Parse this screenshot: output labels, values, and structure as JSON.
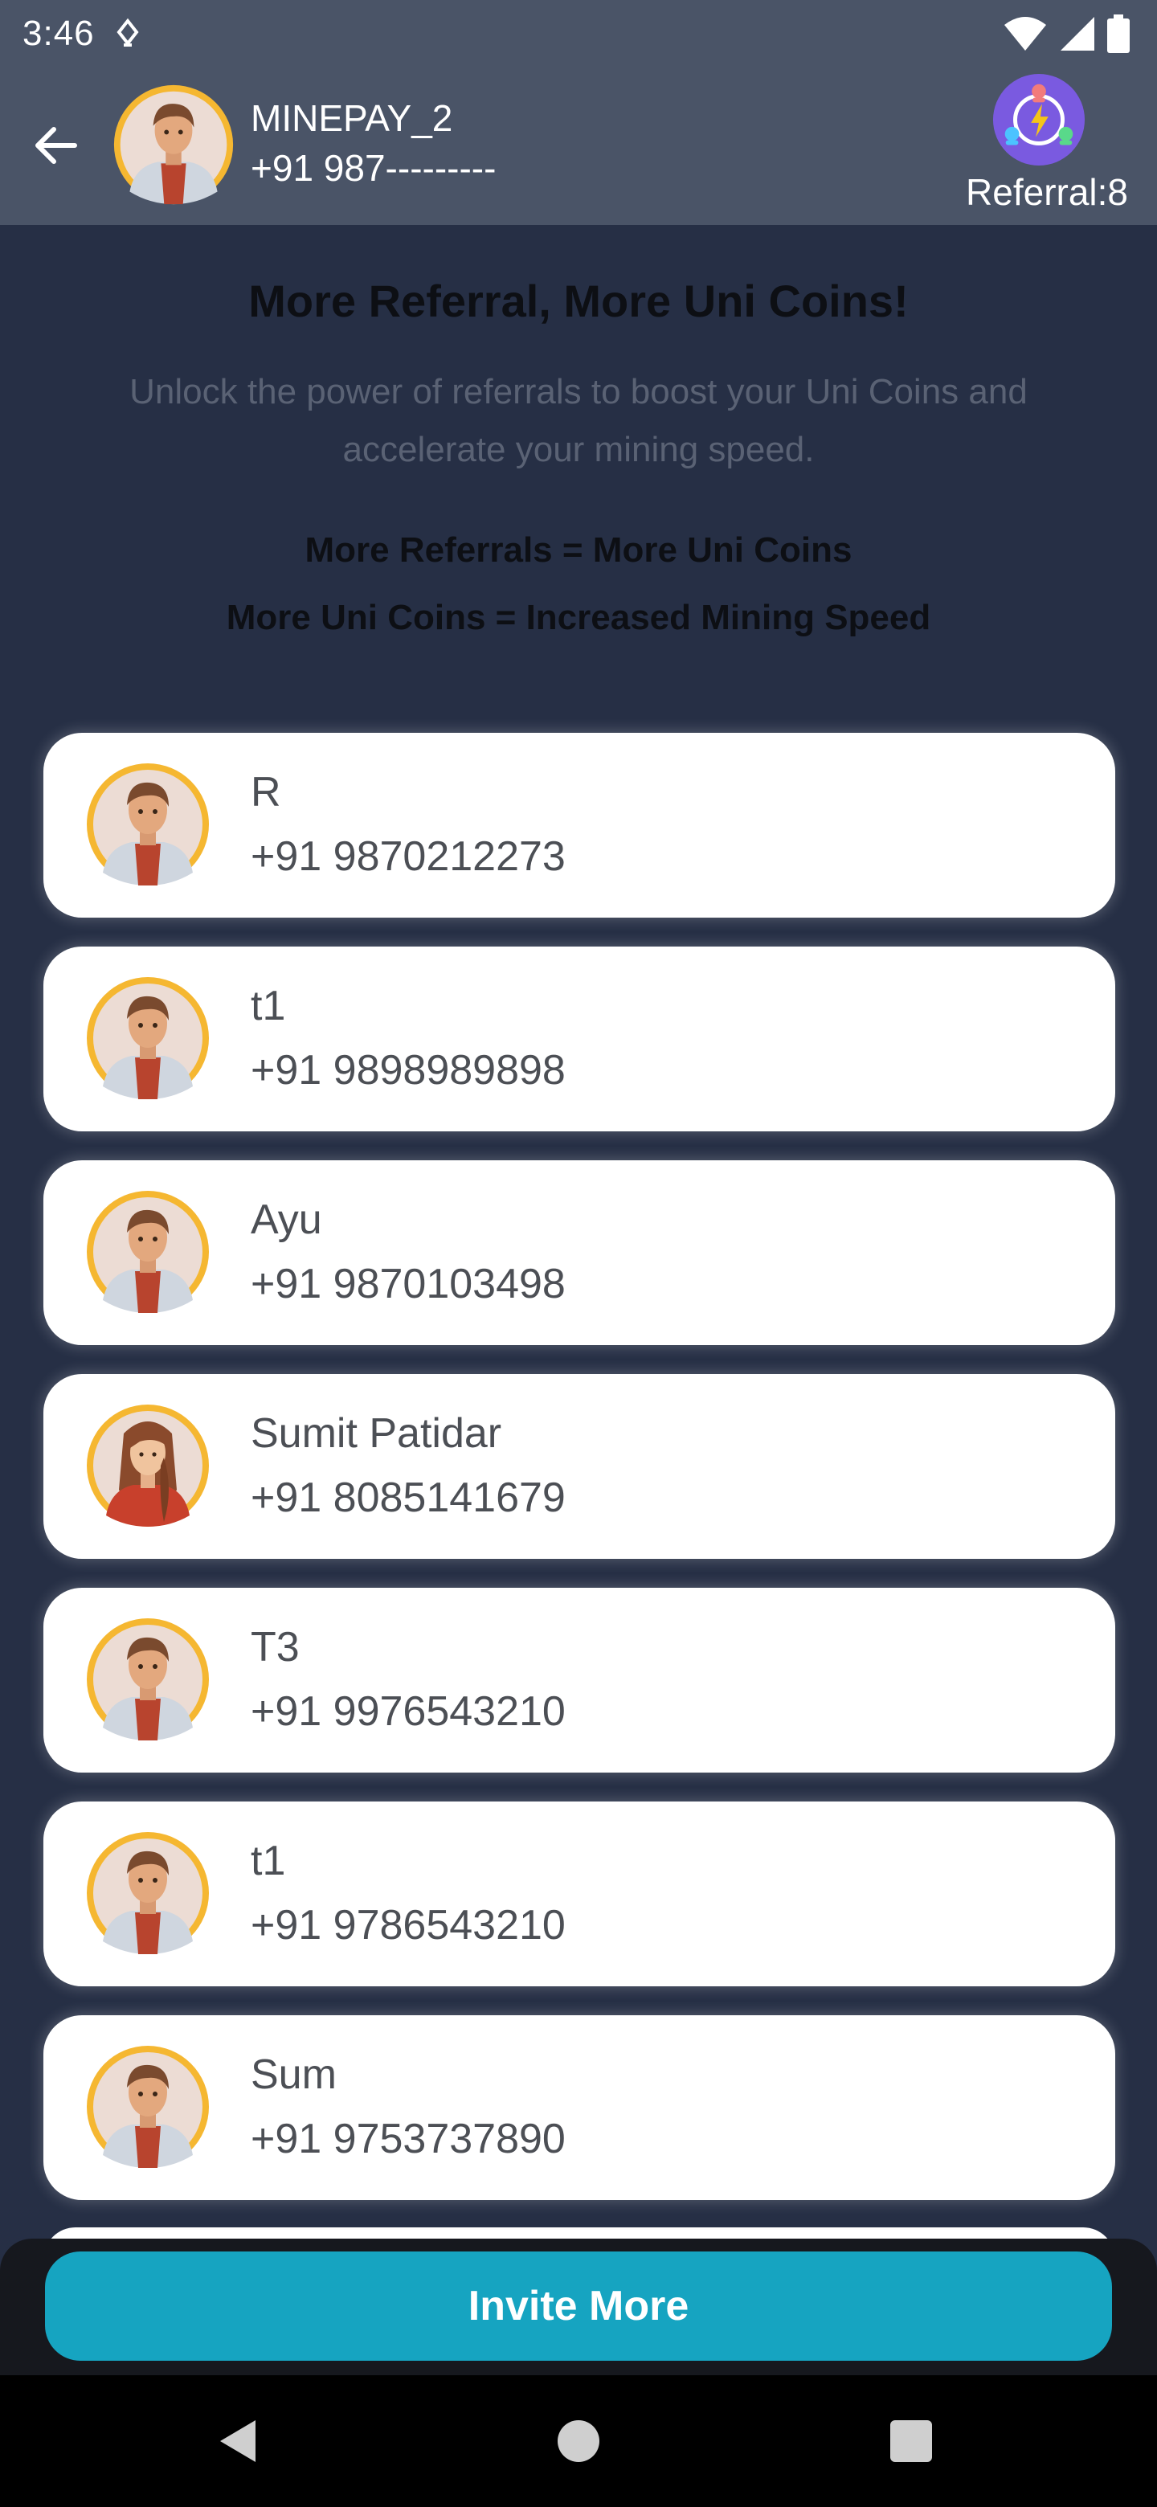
{
  "status_bar": {
    "time": "3:46"
  },
  "header": {
    "user_name": "MINEPAY_2",
    "user_phone": "+91 987---------",
    "referral_label": "Referral:8"
  },
  "intro": {
    "title": "More Referral, More Uni Coins!",
    "description": "Unlock the power of referrals to boost your Uni Coins and accelerate your mining speed.",
    "line1": "More Referrals = More Uni Coins",
    "line2": "More Uni Coins = Increased Mining Speed"
  },
  "referrals": [
    {
      "name": "R",
      "phone": "+91 9870212273",
      "avatar": "male-avatar-icon"
    },
    {
      "name": "t1",
      "phone": "+91 9898989898",
      "avatar": "male-avatar-icon"
    },
    {
      "name": "Ayu",
      "phone": "+91 9870103498",
      "avatar": "male-avatar-icon"
    },
    {
      "name": "Sumit Patidar",
      "phone": "+91 8085141679",
      "avatar": "female-avatar-icon"
    },
    {
      "name": "T3",
      "phone": "+91 9976543210",
      "avatar": "male-avatar-icon"
    },
    {
      "name": "t1",
      "phone": "+91 9786543210",
      "avatar": "male-avatar-icon"
    },
    {
      "name": "Sum",
      "phone": "+91 9753737890",
      "avatar": "male-avatar-icon"
    }
  ],
  "invite_button_label": "Invite More",
  "colors": {
    "background": "#262f45",
    "header": "#4a5467",
    "card": "#ffffff",
    "accent": "#16a4c1",
    "avatar_ring": "#f5b731"
  }
}
